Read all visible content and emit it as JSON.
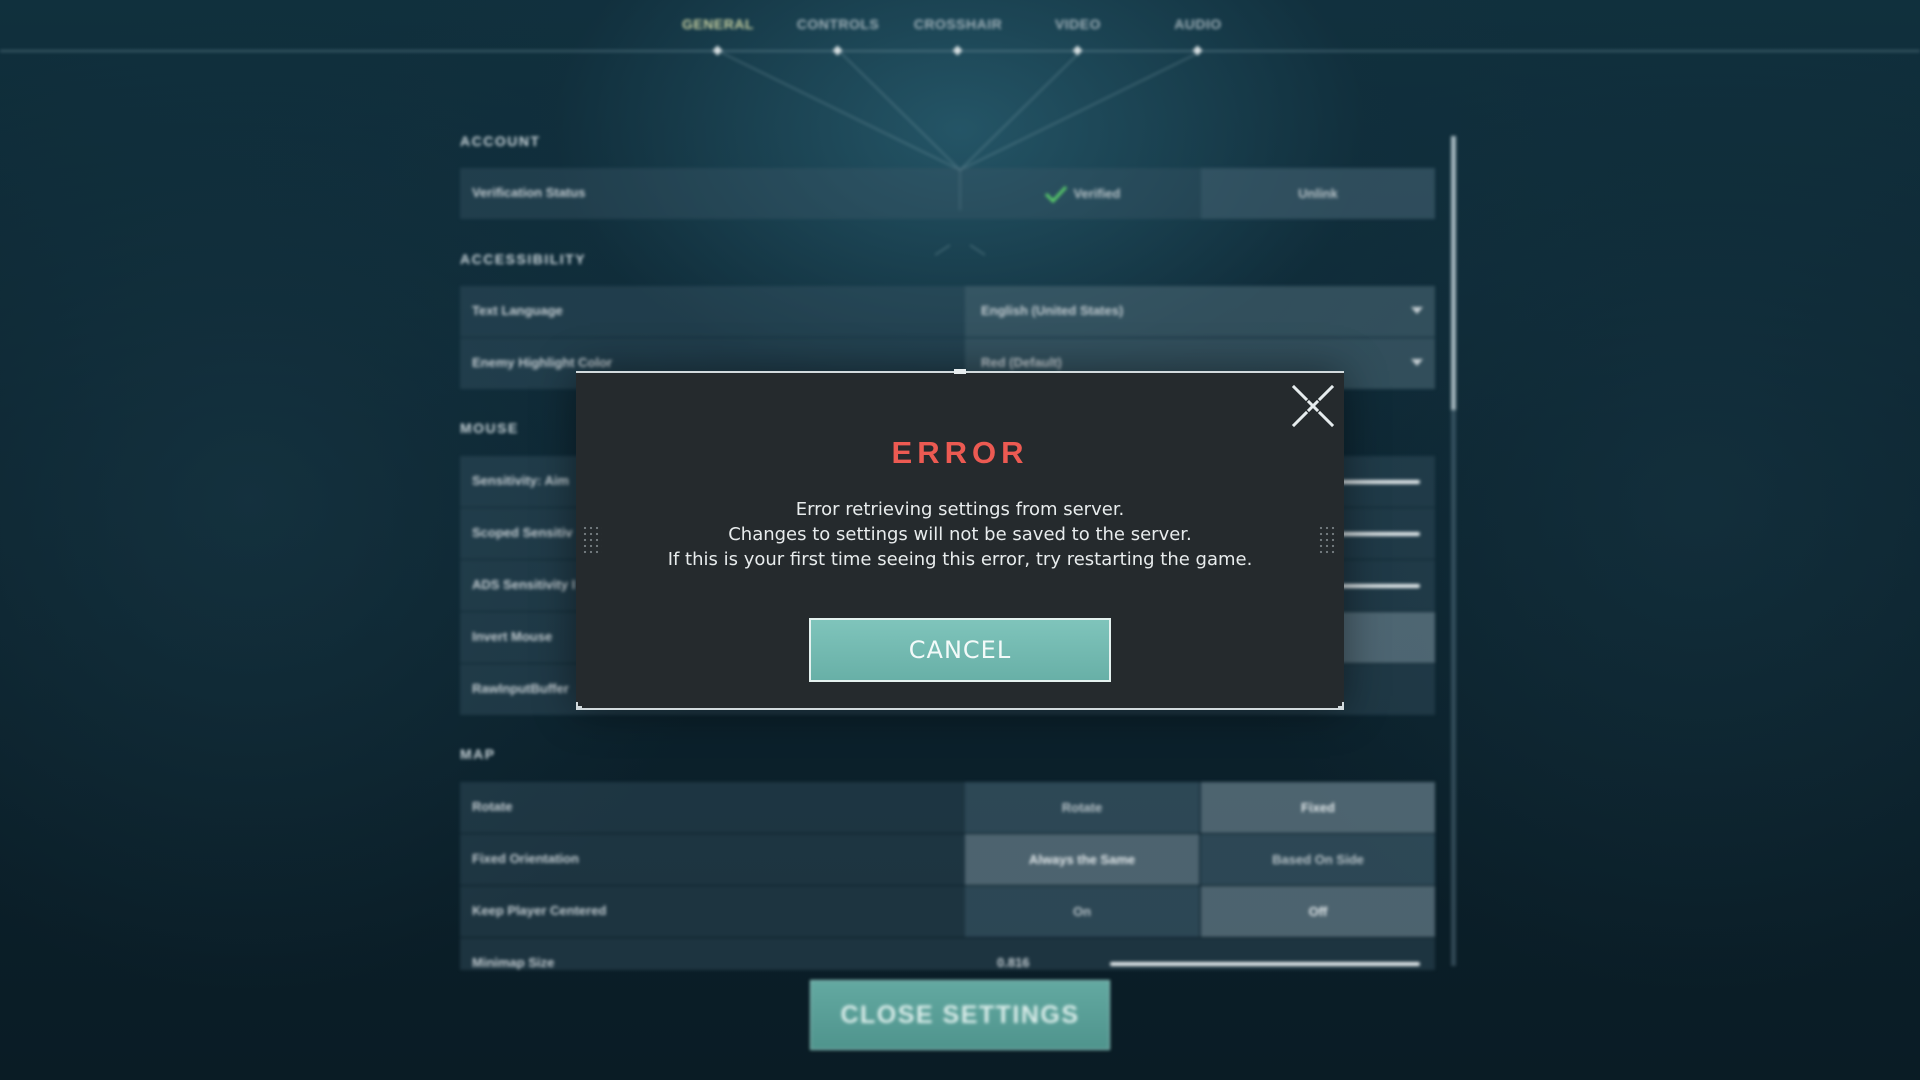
{
  "tabs": [
    {
      "label": "GENERAL",
      "active": true
    },
    {
      "label": "CONTROLS",
      "active": false
    },
    {
      "label": "CROSSHAIR",
      "active": false
    },
    {
      "label": "VIDEO",
      "active": false
    },
    {
      "label": "AUDIO",
      "active": false
    }
  ],
  "account": {
    "title": "ACCOUNT",
    "verification_label": "Verification Status",
    "verified_text": "Verified",
    "unlink_label": "Unlink"
  },
  "accessibility": {
    "title": "ACCESSIBILITY",
    "text_language_label": "Text Language",
    "text_language_value": "English (United States)",
    "enemy_highlight_label": "Enemy Highlight Color",
    "enemy_highlight_value": "Red (Default)"
  },
  "mouse": {
    "title": "MOUSE",
    "sensitivity_aim_label": "Sensitivity: Aim",
    "scoped_sensitivity_label": "Scoped Sensitiv",
    "ads_sensitivity_label": "ADS Sensitivity I",
    "invert_mouse_label": "Invert Mouse",
    "raw_input_label": "RawInputBuffer"
  },
  "map": {
    "title": "MAP",
    "rotate_label": "Rotate",
    "rotate_options": [
      "Rotate",
      "Fixed"
    ],
    "fixed_orientation_label": "Fixed Orientation",
    "fixed_orientation_options": [
      "Always the Same",
      "Based On Side"
    ],
    "keep_centered_label": "Keep Player Centered",
    "keep_centered_options": [
      "On",
      "Off"
    ],
    "minimap_size_label": "Minimap Size",
    "minimap_size_value": "0.816"
  },
  "close_settings_label": "CLOSE SETTINGS",
  "error_modal": {
    "title": "ERROR",
    "message_line1": "Error retrieving settings from server.",
    "message_line2": "Changes to settings will not be saved to the server.",
    "message_line3": "If this is your first time seeing this error, try restarting the game.",
    "cancel_label": "CANCEL"
  },
  "colors": {
    "error_red": "#ec5a52",
    "accent_teal": "#7fc4bb",
    "modal_bg": "#252a2d"
  }
}
